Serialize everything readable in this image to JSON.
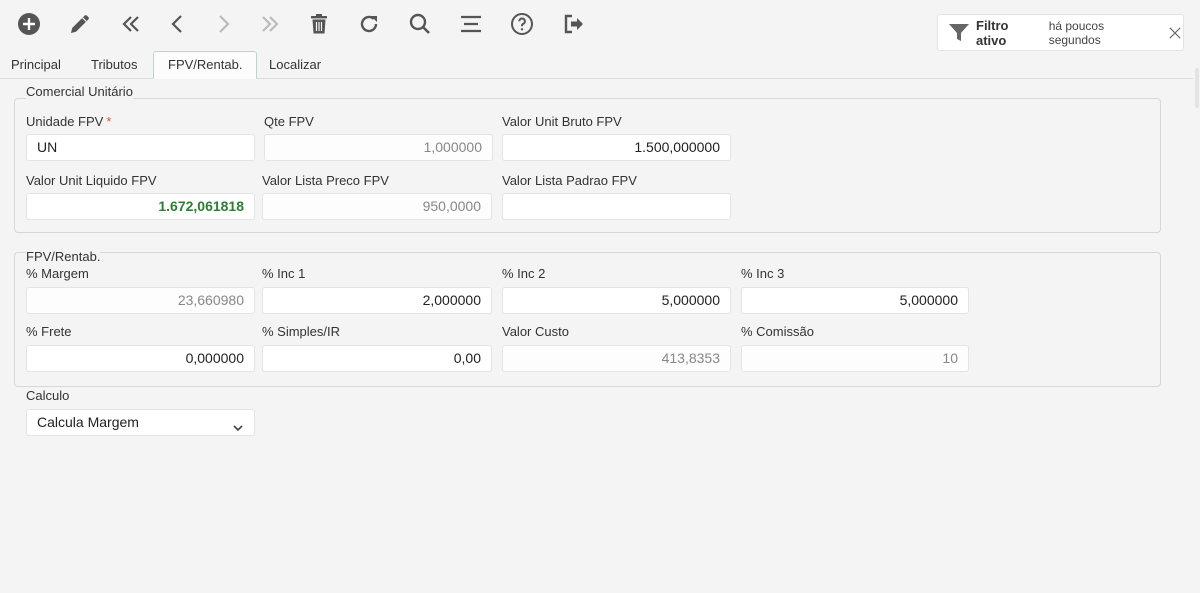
{
  "toolbar": {
    "icons": [
      "add-icon",
      "edit-icon",
      "first-icon",
      "previous-icon",
      "next-icon",
      "last-icon",
      "delete-icon",
      "refresh-icon",
      "search-icon",
      "list-icon",
      "help-icon",
      "exit-icon"
    ]
  },
  "filter": {
    "title": "Filtro ativo",
    "time": "há poucos segundos"
  },
  "tabs": [
    {
      "label": "Principal"
    },
    {
      "label": "Tributos"
    },
    {
      "label": "FPV/Rentab."
    },
    {
      "label": "Localizar"
    }
  ],
  "comercial": {
    "legend": "Comercial Unitário",
    "unidade_fpv": {
      "label": "Unidade FPV",
      "required": "*",
      "value": "UN"
    },
    "qte_fpv": {
      "label": "Qte FPV",
      "value": "1,000000"
    },
    "valor_unit_bruto": {
      "label": "Valor Unit Bruto FPV",
      "value": "1.500,000000"
    },
    "valor_unit_liquido": {
      "label": "Valor Unit Liquido FPV",
      "value": "1.672,061818"
    },
    "valor_lista_preco": {
      "label": "Valor Lista Preco FPV",
      "value": "950,0000"
    },
    "valor_lista_padrao": {
      "label": "Valor Lista Padrao FPV",
      "value": ""
    }
  },
  "rentab": {
    "legend": "FPV/Rentab.",
    "margem": {
      "label": "% Margem",
      "value": "23,660980"
    },
    "inc1": {
      "label": "% Inc 1",
      "value": "2,000000"
    },
    "inc2": {
      "label": "% Inc 2",
      "value": "5,000000"
    },
    "inc3": {
      "label": "% Inc 3",
      "value": "5,000000"
    },
    "frete": {
      "label": "% Frete",
      "value": "0,000000"
    },
    "simples": {
      "label": "% Simples/IR",
      "value": "0,00"
    },
    "custo": {
      "label": "Valor Custo",
      "value": "413,8353"
    },
    "comissao": {
      "label": "% Comissão",
      "value": "10"
    }
  },
  "calculo": {
    "label": "Calculo",
    "value": "Calcula Margem"
  },
  "colors": {
    "icon": "#555555",
    "icon_disabled": "#bbbbbb",
    "green_value": "#2e7d32",
    "tab_border": "#b9d9c8"
  }
}
